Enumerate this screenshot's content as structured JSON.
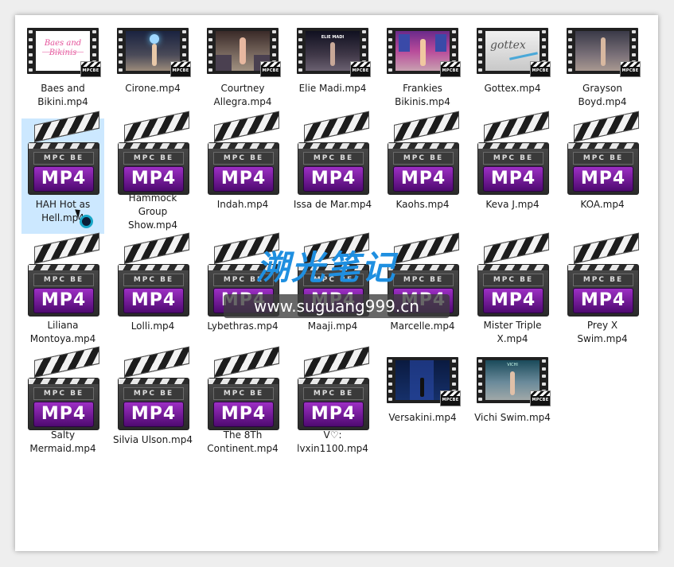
{
  "files": [
    {
      "label": "Baes and Bikini.mp4",
      "icon": "thumbnail",
      "thumb_text": "Baes and Bikinis",
      "badge": "MPCBE"
    },
    {
      "label": "Cirone.mp4",
      "icon": "thumbnail",
      "badge": "MPCBE"
    },
    {
      "label": "Courtney Allegra.mp4",
      "icon": "thumbnail",
      "badge": "MPCBE"
    },
    {
      "label": "Elie Madi.mp4",
      "icon": "thumbnail",
      "thumb_text": "ELIE MADI",
      "badge": "MPCBE"
    },
    {
      "label": "Frankies Bikinis.mp4",
      "icon": "thumbnail",
      "badge": "MPCBE"
    },
    {
      "label": "Gottex.mp4",
      "icon": "thumbnail",
      "thumb_text": "gottex",
      "badge": "MPCBE"
    },
    {
      "label": "Grayson Boyd.mp4",
      "icon": "thumbnail",
      "badge": "MPCBE"
    },
    {
      "label": "HAH Hot as Hell.mp4",
      "icon": "clapper",
      "selected": true
    },
    {
      "label": "Hammock Group Show.mp4",
      "icon": "clapper"
    },
    {
      "label": "Indah.mp4",
      "icon": "clapper"
    },
    {
      "label": "Issa de Mar.mp4",
      "icon": "clapper"
    },
    {
      "label": "Kaohs.mp4",
      "icon": "clapper"
    },
    {
      "label": "Keva J.mp4",
      "icon": "clapper"
    },
    {
      "label": "KOA.mp4",
      "icon": "clapper"
    },
    {
      "label": "Liliana Montoya.mp4",
      "icon": "clapper"
    },
    {
      "label": "Lolli.mp4",
      "icon": "clapper"
    },
    {
      "label": "Lybethras.mp4",
      "icon": "clapper"
    },
    {
      "label": "Maaji.mp4",
      "icon": "clapper"
    },
    {
      "label": "Marcelle.mp4",
      "icon": "clapper"
    },
    {
      "label": "Mister Triple X.mp4",
      "icon": "clapper"
    },
    {
      "label": "Prey X Swim.mp4",
      "icon": "clapper"
    },
    {
      "label": "Salty Mermaid.mp4",
      "icon": "clapper"
    },
    {
      "label": "Silvia Ulson.mp4",
      "icon": "clapper"
    },
    {
      "label": "The 8Th Continent.mp4",
      "icon": "clapper"
    },
    {
      "label": "V♡: lvxin1100.mp4",
      "icon": "clapper"
    },
    {
      "label": "Versakini.mp4",
      "icon": "thumbnail",
      "badge": "MPCBE"
    },
    {
      "label": "Vichi Swim.mp4",
      "icon": "thumbnail",
      "thumb_text": "VICHI",
      "badge": "MPCBE"
    }
  ],
  "clapper_band_text": "MPC BE",
  "clapper_format_text": "MP4",
  "watermark": {
    "cn_text": "溯光笔记",
    "url": "www.suguang999.cn"
  },
  "colors": {
    "selection": "#cce8ff",
    "mp4_purple": "#7a1fa8",
    "watermark_blue": "#1f8fe0",
    "watermark_green": "#5cbf1e"
  }
}
